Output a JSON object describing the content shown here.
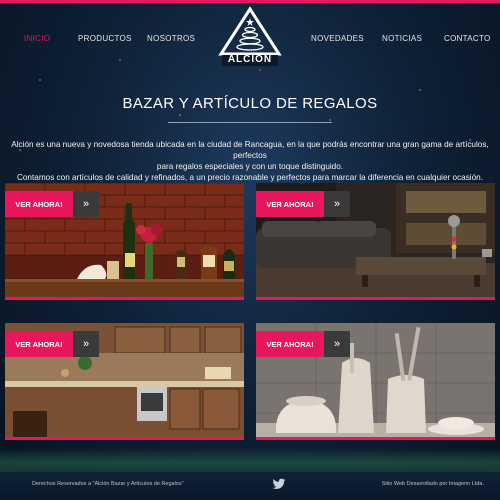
{
  "nav": {
    "inicio": "INICIO",
    "productos": "PRODUCTOS",
    "nosotros": "NOSOTROS",
    "novedades": "NOVEDADES",
    "noticias": "NOTICIAS",
    "contacto": "CONTACTO"
  },
  "logo": {
    "text": "ALCION",
    "icon": "triangle-zen-stones-icon"
  },
  "main": {
    "title": "BAZAR Y ARTÍCULO DE REGALOS",
    "intro_line1": "Alción es una nueva y novedosa tienda ubicada en la ciudad de Rancagua, en la que podrás encontrar una gran gama de artículos, perfectos",
    "intro_line2": "para regalos especiales y con un toque distinguido.",
    "intro_line3": "Contamos con artículos de calidad y refinados, a un precio razonable y perfectos para marcar la diferencia en cualquier ocasión."
  },
  "cards": [
    {
      "button": "VER AHORA!",
      "arrow": "»"
    },
    {
      "button": "VER AHORA!",
      "arrow": "»"
    },
    {
      "button": "VER AHORA!",
      "arrow": "»"
    },
    {
      "button": "VER AHORA!",
      "arrow": "»"
    }
  ],
  "footer": {
    "left": "Derechos Reservados a \"Alción Bazar y Artículos de Regalos\"",
    "right": "Sitio Web Desarrollado por Imagenn Ltda.",
    "social_icon": "twitter-icon"
  },
  "colors": {
    "accent": "#e8175d",
    "arrow_bg": "#3a3a3a"
  }
}
